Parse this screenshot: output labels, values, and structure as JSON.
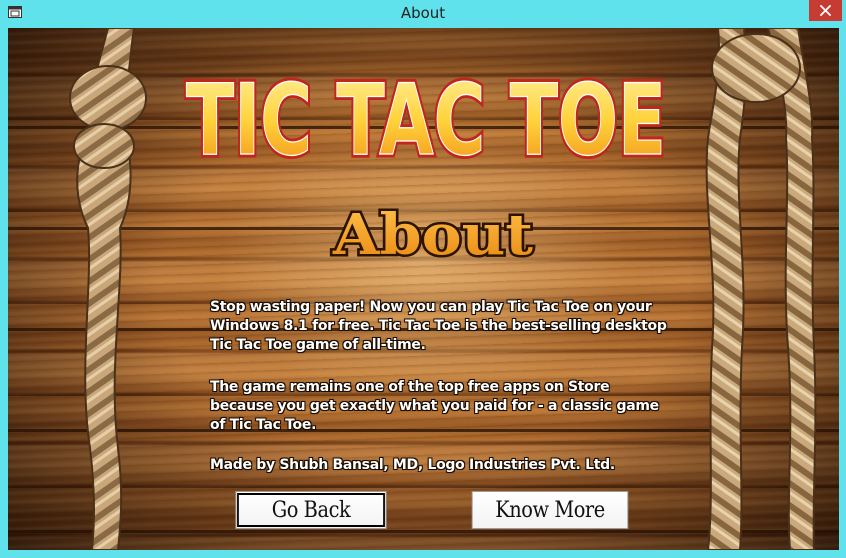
{
  "window": {
    "title": "About"
  },
  "logo": {
    "text": "TIC TAC TOE"
  },
  "heading": "About",
  "paragraphs": [
    "Stop wasting paper! Now you can play Tic Tac Toe on your Windows 8.1 for free. Tic Tac Toe is the best-selling desktop Tic Tac Toe game of all-time.",
    "The game  remains one of the top free apps on Store because you get exactly what you paid for - a classic game of Tic Tac Toe.",
    "Made by Shubh Bansal, MD, Logo Industries Pvt. Ltd."
  ],
  "buttons": {
    "go_back": "Go Back",
    "know_more": "Know More"
  },
  "colors": {
    "titlebar": "#5fe2ec",
    "close_button": "#c73c32",
    "logo_fill": "#ffd23a",
    "logo_outline": "#c0261a",
    "heading_fill": "#f2a21c"
  },
  "icons": {
    "app": "window-icon",
    "close": "close-icon"
  }
}
